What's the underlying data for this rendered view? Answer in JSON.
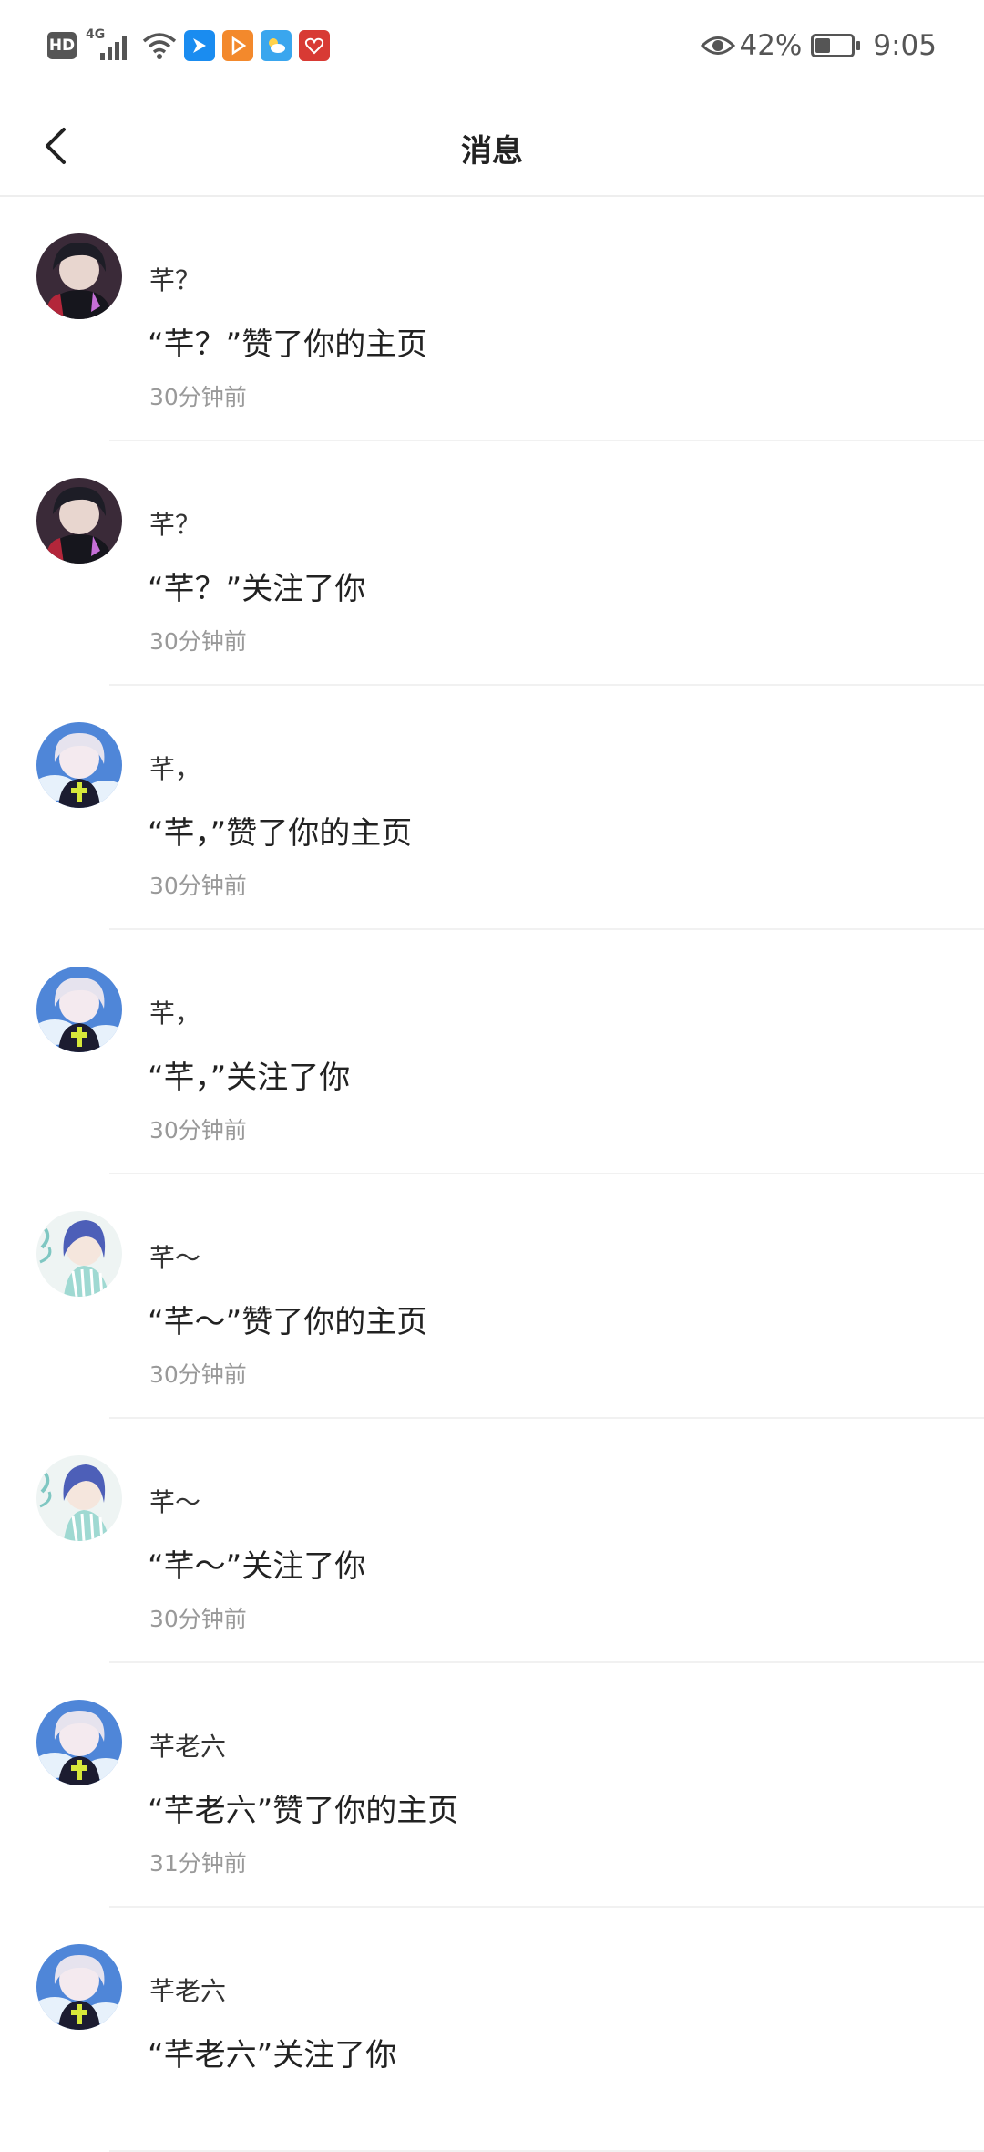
{
  "status_bar": {
    "hd": "HD",
    "network": "4G",
    "battery_percent": "42%",
    "battery_level": 0.42,
    "time": "9:05",
    "app_icons": [
      {
        "name": "bird-app-icon",
        "color": "#1a8cf0"
      },
      {
        "name": "play-app-icon",
        "color": "#f3892c"
      },
      {
        "name": "weather-app-icon",
        "color": "#3aa6ee"
      },
      {
        "name": "heart-app-icon",
        "color": "#d83a34"
      }
    ]
  },
  "header": {
    "title": "消息",
    "back_icon": "chevron-left-icon"
  },
  "messages": [
    {
      "name": "芊？",
      "text": "“芊？”赞了你的主页",
      "time": "30分钟前",
      "avatar": "dark"
    },
    {
      "name": "芊？",
      "text": "“芊？”关注了你",
      "time": "30分钟前",
      "avatar": "dark"
    },
    {
      "name": "芊，",
      "text": "“芊，”赞了你的主页",
      "time": "30分钟前",
      "avatar": "white"
    },
    {
      "name": "芊，",
      "text": "“芊，”关注了你",
      "time": "30分钟前",
      "avatar": "white"
    },
    {
      "name": "芊～",
      "text": "“芊～”赞了你的主页",
      "time": "30分钟前",
      "avatar": "blue"
    },
    {
      "name": "芊～",
      "text": "“芊～”关注了你",
      "time": "30分钟前",
      "avatar": "blue"
    },
    {
      "name": "芊老六",
      "text": "“芊老六”赞了你的主页",
      "time": "31分钟前",
      "avatar": "white"
    },
    {
      "name": "芊老六",
      "text": "“芊老六”关注了你",
      "time": "",
      "avatar": "white"
    }
  ]
}
